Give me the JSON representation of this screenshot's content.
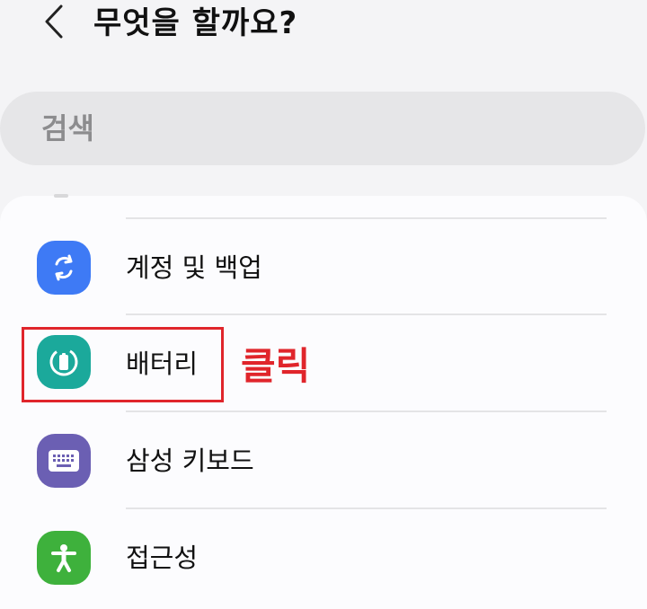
{
  "header": {
    "title": "무엇을 할까요?",
    "back_icon": "chevron-left-icon"
  },
  "search": {
    "placeholder": "검색",
    "value": ""
  },
  "settings_list": [
    {
      "label": "계정 및 백업",
      "icon": "sync-icon",
      "icon_color": "#3e7af5"
    },
    {
      "label": "배터리",
      "icon": "battery-icon",
      "icon_color": "#1ba99b"
    },
    {
      "label": "삼성 키보드",
      "icon": "keyboard-icon",
      "icon_color": "#6b5fb3"
    },
    {
      "label": "접근성",
      "icon": "accessibility-icon",
      "icon_color": "#3eb13c"
    }
  ],
  "annotation": {
    "text": "클릭",
    "color": "#e0252b",
    "target": "배터리"
  }
}
